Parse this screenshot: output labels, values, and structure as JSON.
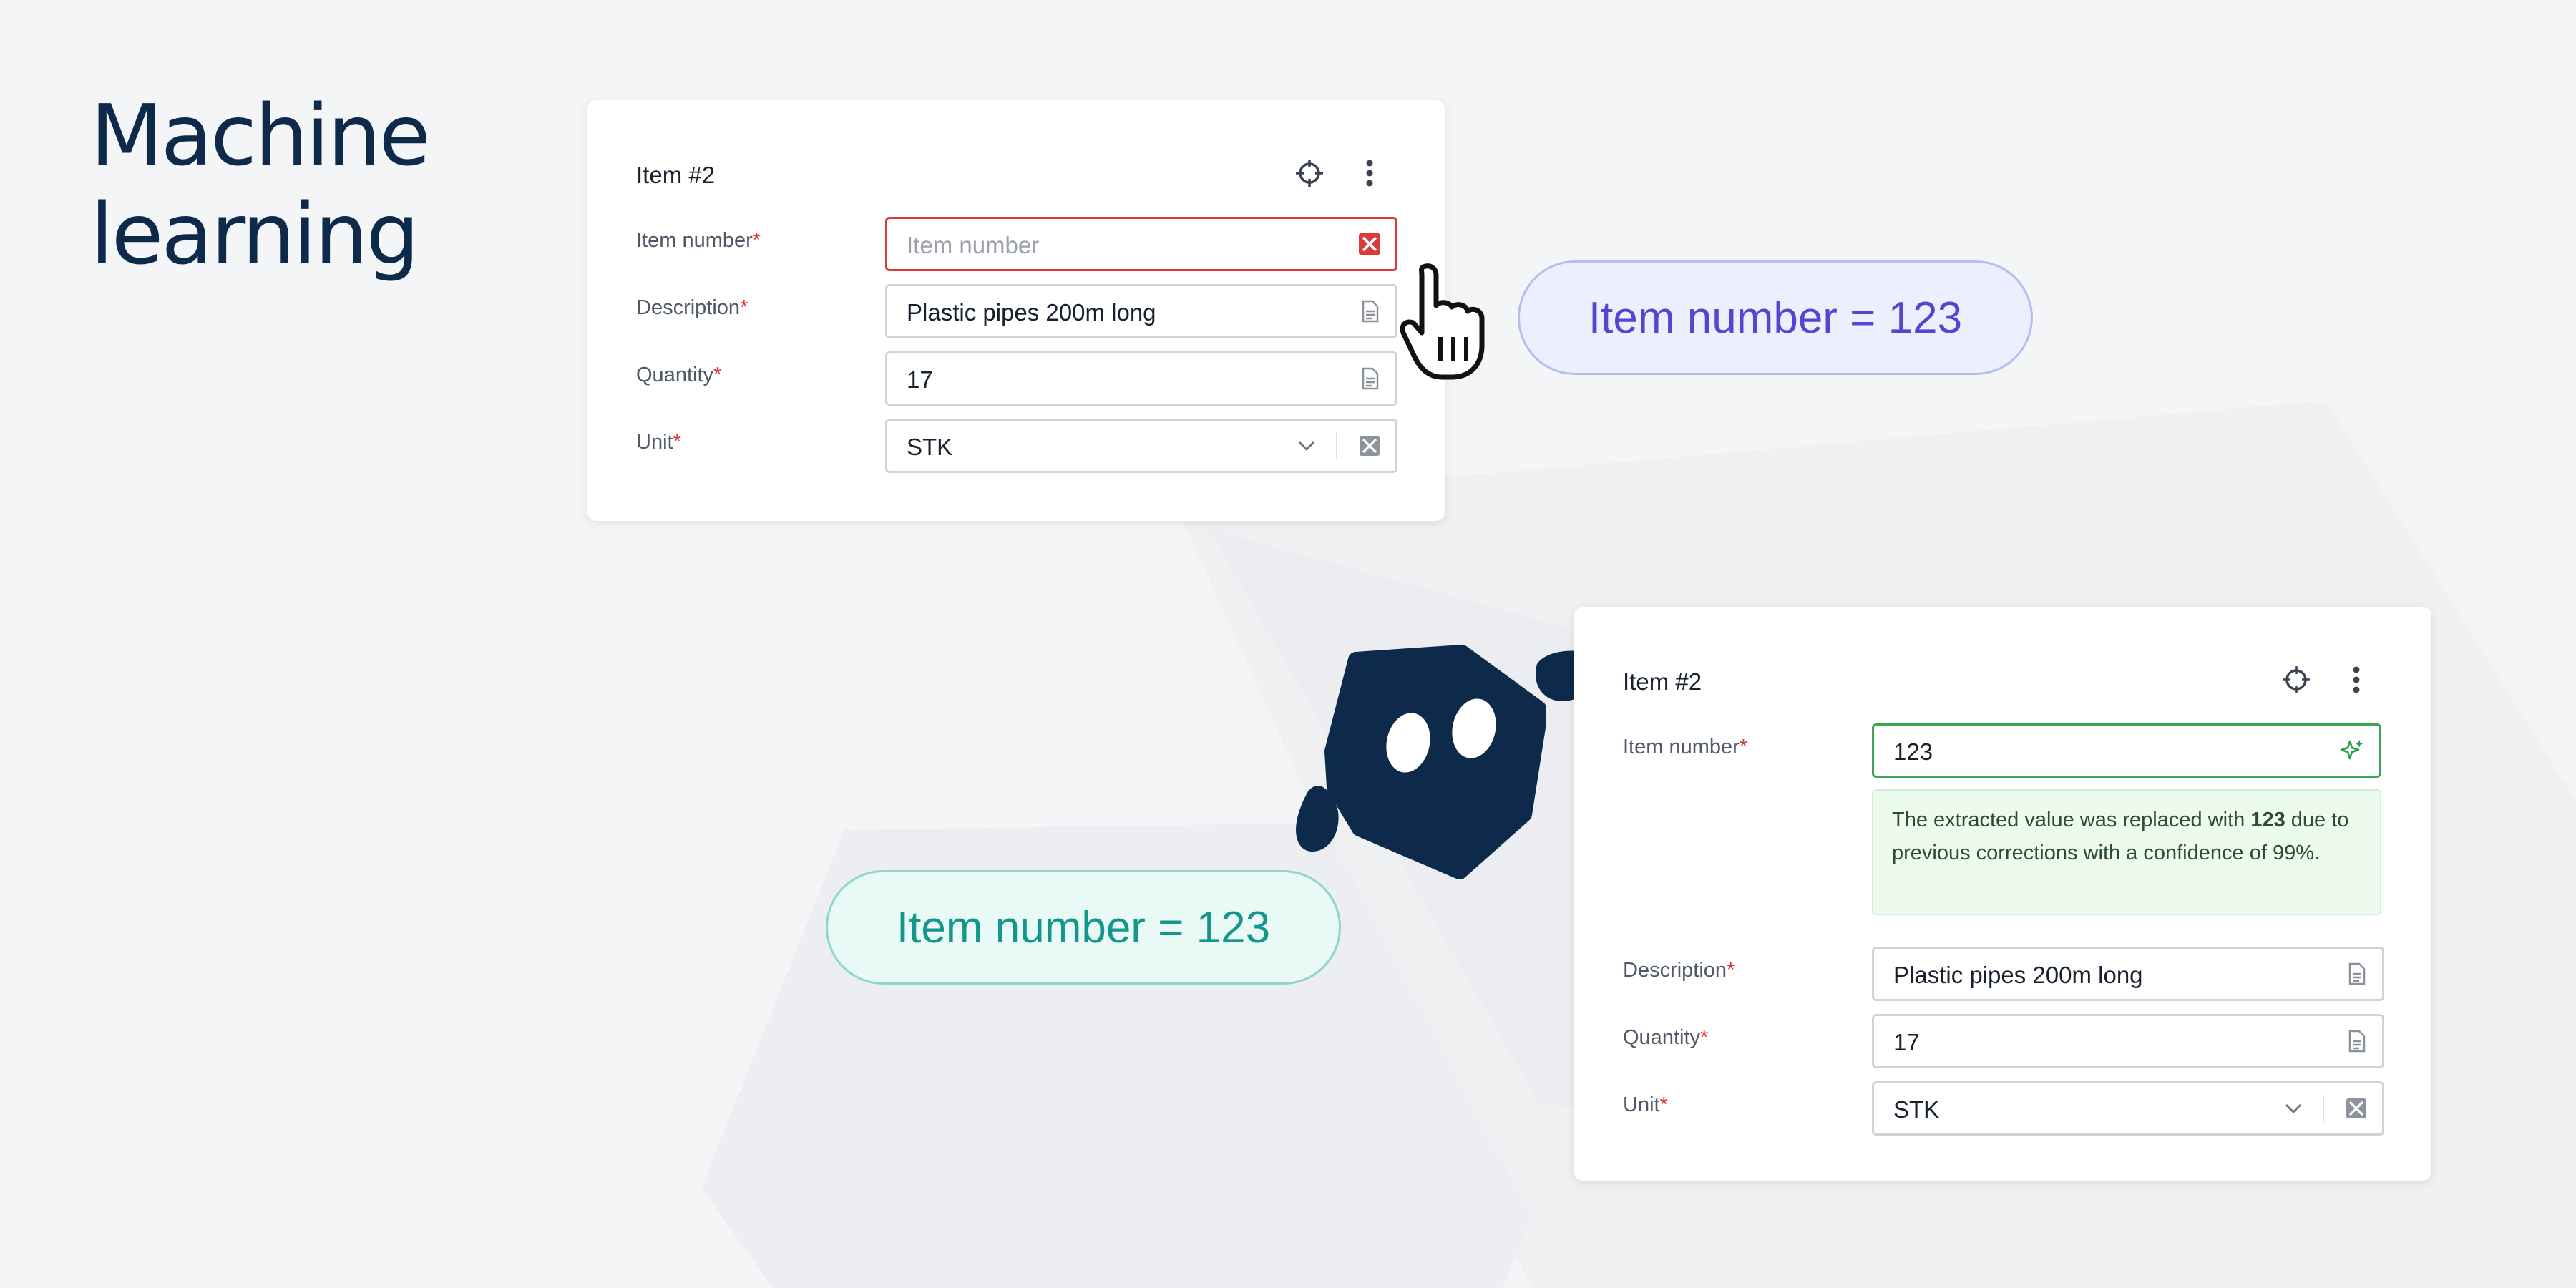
{
  "headline": {
    "line1": "Machine",
    "line2": "learning"
  },
  "form_before": {
    "title": "Item #2",
    "fields": [
      {
        "label": "Item number",
        "required_mark": "*",
        "value": "",
        "placeholder": "Item number",
        "state": "error",
        "icon": "error-x-icon"
      },
      {
        "label": "Description",
        "required_mark": "*",
        "value": "Plastic pipes 200m long",
        "icon": "document-icon"
      },
      {
        "label": "Quantity",
        "required_mark": "*",
        "value": "17",
        "icon": "document-icon"
      },
      {
        "label": "Unit",
        "required_mark": "*",
        "value": "STK",
        "icon": "chevron-down-icon"
      }
    ]
  },
  "form_after": {
    "title": "Item #2",
    "fields": [
      {
        "label": "Item number",
        "required_mark": "*",
        "value": "123",
        "state": "success",
        "icon": "sparkle-icon"
      },
      {
        "label": "Description",
        "required_mark": "*",
        "value": "Plastic pipes 200m long",
        "icon": "document-icon"
      },
      {
        "label": "Quantity",
        "required_mark": "*",
        "value": "17",
        "icon": "document-icon"
      },
      {
        "label": "Unit",
        "required_mark": "*",
        "value": "STK",
        "icon": "chevron-down-icon"
      }
    ],
    "info": {
      "prefix": "The extracted value was replaced with ",
      "highlight": "123",
      "suffix": " due to previous corrections with a confidence of 99%."
    }
  },
  "pill_user": {
    "text": "Item number = 123"
  },
  "pill_model": {
    "text": "Item number = 123"
  },
  "colors": {
    "headline": "#0e2a4b",
    "error": "#d93a3a",
    "success": "#3aa655",
    "user_pill": "#5347cf",
    "model_pill": "#12978a",
    "robot": "#0d2a4a"
  }
}
